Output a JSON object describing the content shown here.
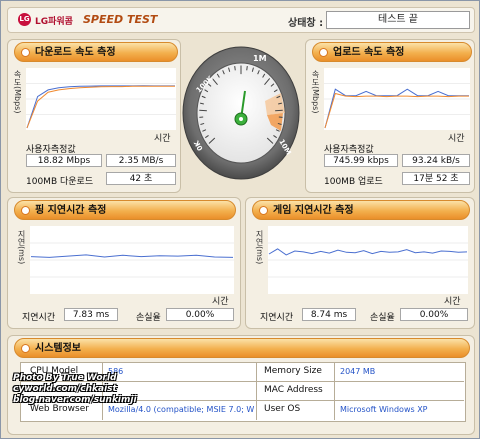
{
  "header": {
    "brand": "LG파워콤",
    "title": "SPEED TEST",
    "status_label": "상태창 :",
    "status_value": "테스트 끝"
  },
  "download": {
    "title": "다운로드 속도 측정",
    "y_label": "속도(Mbps)",
    "x_label": "시간",
    "user_speed_label": "사용자측정값",
    "mbps": "18.82 Mbps",
    "mbs": "2.35 MB/s",
    "time_label": "100MB 다운로드",
    "time_value": "42 초"
  },
  "gauge": {
    "label_100k": "100K",
    "label_1m": "1M",
    "label_10m": "10M",
    "label_0k": "0K"
  },
  "upload": {
    "title": "업로드 속도 측정",
    "y_label": "속도(Mbps)",
    "x_label": "시간",
    "user_speed_label": "사용자측정값",
    "kbps": "745.99 kbps",
    "kbs": "93.24 kB/s",
    "time_label": "100MB 업로드",
    "time_value": "17분 52 초"
  },
  "ping": {
    "title": "핑 지연시간 측정",
    "y_label": "지연(ms)",
    "x_label": "시간",
    "latency_label": "지연시간",
    "latency_value": "7.83 ms",
    "loss_label": "손실율",
    "loss_value": "0.00%"
  },
  "game": {
    "title": "게임 지연시간 측정",
    "y_label": "지연(ms)",
    "x_label": "시간",
    "latency_label": "지연시간",
    "latency_value": "8.74 ms",
    "loss_label": "손실율",
    "loss_value": "0.00%"
  },
  "system": {
    "title": "시스템정보",
    "cpu_label": "CPU Model",
    "cpu_value": "586",
    "host_label": "Host IP",
    "host_value": "",
    "browser_label": "Web Browser",
    "browser_value": "Mozilla/4.0 (compatible; MSIE 7.0; Wind",
    "memory_label": "Memory Size",
    "memory_value": "2047 MB",
    "mac_label": "MAC Address",
    "mac_value": "",
    "os_label": "User OS",
    "os_value": "Microsoft Windows XP"
  },
  "watermark": {
    "line1": "Photo By True World",
    "line2": "cyworld.com/chkaist",
    "line3": "blog.naver.com/sunkimji"
  },
  "colors": {
    "accent": "#f0a040",
    "line_blue": "#4a6fd0",
    "line_orange": "#f08a30",
    "value_text": "#2453c7"
  },
  "chart_data": [
    {
      "type": "line",
      "title": "다운로드 속도 측정",
      "ylabel": "속도(Mbps)",
      "xlabel": "시간",
      "series": [
        {
          "values": [
            0,
            14,
            17,
            18,
            18.4,
            18.6,
            18.7,
            18.8,
            18.8,
            18.8,
            18.8,
            18.9,
            18.8,
            18.8,
            18.8
          ]
        },
        {
          "values": [
            0,
            12,
            16,
            17,
            17.6,
            18,
            18.2,
            18.4,
            18.5,
            18.5,
            18.6,
            18.6,
            18.6,
            18.6,
            18.6
          ]
        }
      ]
    },
    {
      "type": "line",
      "title": "업로드 속도 측정",
      "ylabel": "속도(Mbps)",
      "xlabel": "시간",
      "series": [
        {
          "values": [
            0,
            0.9,
            0.75,
            0.75,
            0.85,
            0.75,
            0.75,
            0.75,
            0.9,
            0.75,
            0.75,
            0.85,
            0.75,
            0.75,
            0.75
          ]
        },
        {
          "values": [
            0,
            0.8,
            0.74,
            0.73,
            0.74,
            0.74,
            0.73,
            0.74,
            0.74,
            0.73,
            0.74,
            0.74,
            0.73,
            0.74,
            0.74
          ]
        }
      ]
    },
    {
      "type": "line",
      "title": "핑 지연시간 측정",
      "ylabel": "지연(ms)",
      "xlabel": "시간",
      "series": [
        {
          "values": [
            7.8,
            7.6,
            7.9,
            8.2,
            7.7,
            8.1,
            7.8,
            8.0,
            7.9,
            8.1,
            7.7,
            7.6
          ]
        }
      ]
    },
    {
      "type": "line",
      "title": "게임 지연시간 측정",
      "ylabel": "지연(ms)",
      "xlabel": "시간",
      "series": [
        {
          "values": [
            8.4,
            9.6,
            8.2,
            9.1,
            8.9,
            8.5,
            9.0,
            8.6,
            9.3,
            8.8,
            8.7,
            9.2,
            8.5,
            9.0,
            8.8,
            8.9,
            9.4,
            8.7,
            8.9,
            8.6,
            9.1,
            9.0,
            8.8,
            8.9
          ]
        }
      ]
    }
  ]
}
